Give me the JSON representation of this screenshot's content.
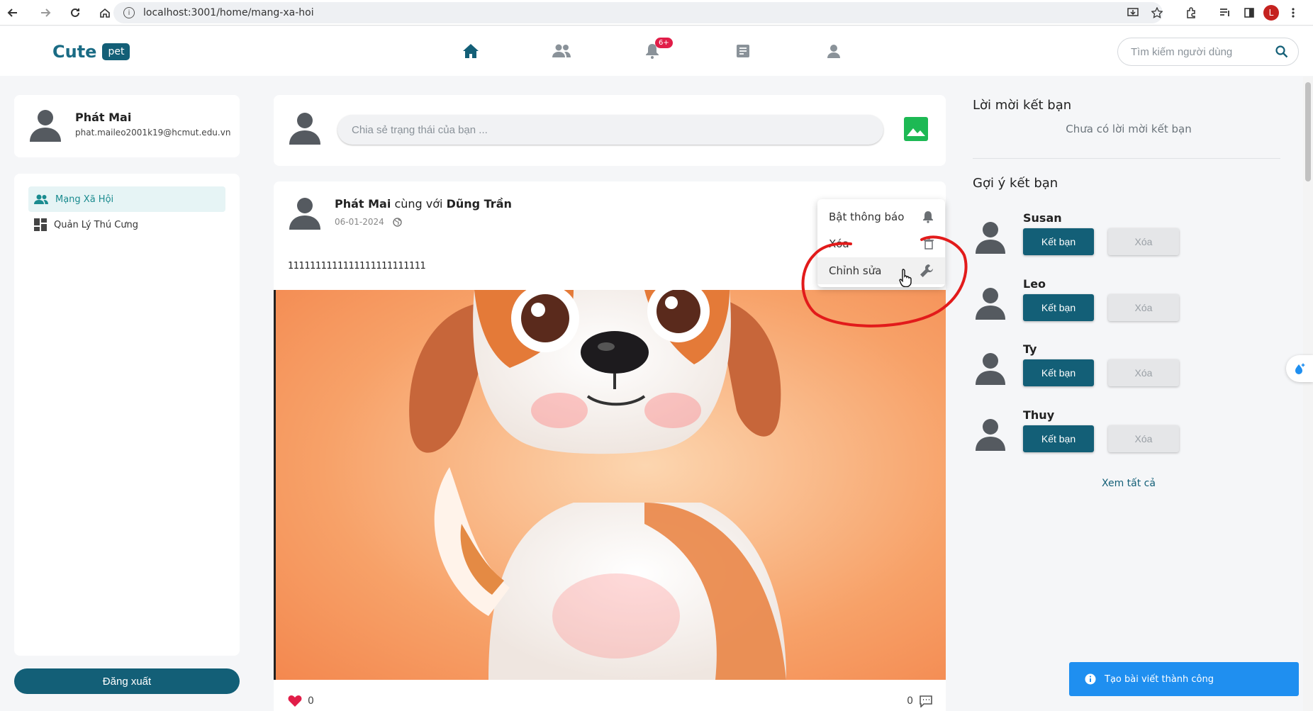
{
  "browser": {
    "url": "localhost:3001/home/mang-xa-hoi",
    "profile_initial": "L"
  },
  "header": {
    "logo_text": "Cute",
    "logo_badge": "pet",
    "notification_badge": "6+",
    "search_placeholder": "Tìm kiếm người dùng",
    "accent_color": "#135f77"
  },
  "sidebar": {
    "user_name": "Phát Mai",
    "user_email": "phat.maileo2001k19@hcmut.edu.vn",
    "items": [
      {
        "label": "Mạng Xã Hội",
        "icon": "people-icon",
        "active": true
      },
      {
        "label": "Quản Lý Thú Cưng",
        "icon": "dashboard-icon",
        "active": false
      }
    ],
    "logout_label": "Đăng xuất"
  },
  "composer": {
    "placeholder": "Chia sẻ trạng thái của bạn ..."
  },
  "post": {
    "author": "Phát Mai",
    "with_text": "cùng với",
    "tagged": "Dũng Trần",
    "date": "06-01-2024",
    "text": "1111111111111111111111111",
    "likes": "0",
    "comments": "0"
  },
  "dropdown": {
    "items": [
      {
        "label": "Bật thông báo",
        "icon": "bell-icon"
      },
      {
        "label": "Xóa",
        "icon": "trash-icon"
      },
      {
        "label": "Chỉnh sửa",
        "icon": "wrench-icon"
      }
    ]
  },
  "right_panel": {
    "friend_requests_title": "Lời mời kết bạn",
    "no_requests_text": "Chưa có lời mời kết bạn",
    "suggestions_title": "Gợi ý kết bạn",
    "add_label": "Kết bạn",
    "remove_label": "Xóa",
    "suggestions": [
      {
        "name": "Susan"
      },
      {
        "name": "Leo"
      },
      {
        "name": "Ty"
      },
      {
        "name": "Thuy"
      }
    ],
    "see_all": "Xem tất cả"
  },
  "toast": {
    "message": "Tạo bài viết thành công",
    "color": "#1f8ff0"
  }
}
